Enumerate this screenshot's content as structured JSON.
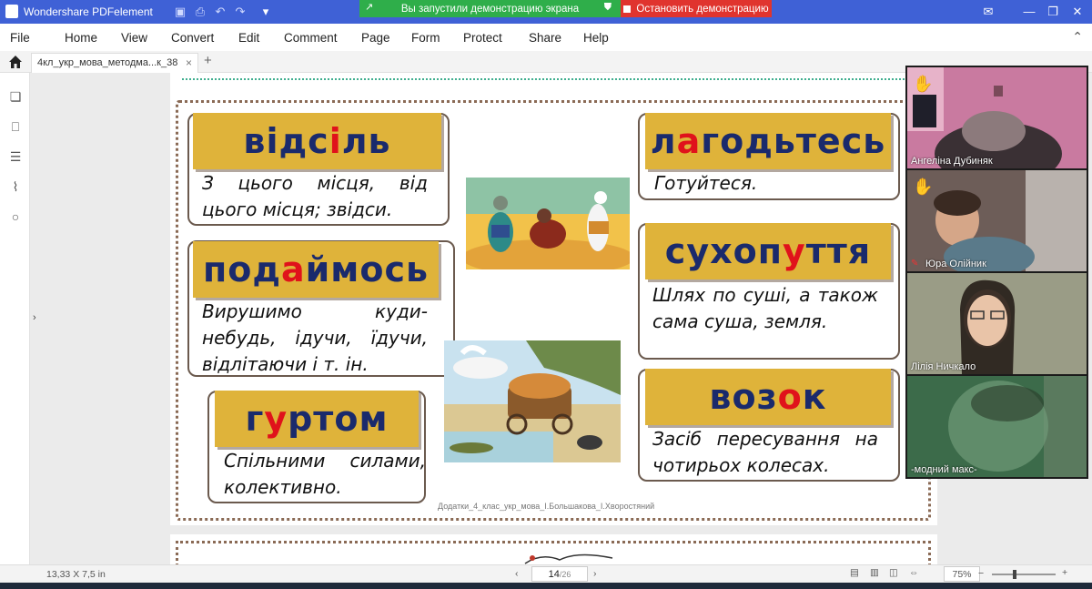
{
  "titlebar": {
    "app_title": "Wondershare PDFelement",
    "share_notice": "Вы запустили демонстрацию экрана",
    "stop_share": "Остановить демонстрацию"
  },
  "menu": [
    "File",
    "Home",
    "View",
    "Convert",
    "Edit",
    "Comment",
    "Page",
    "Form",
    "Protect",
    "Share",
    "Help"
  ],
  "tab": {
    "title": "4кл_укр_мова_методма...к_38",
    "close": "×",
    "add": "+"
  },
  "page": {
    "cards": [
      {
        "word_pre": "відс",
        "word_hl": "і",
        "word_post": "ль",
        "definition": "З цього місця, від цього місця; звідси."
      },
      {
        "word_pre": "под",
        "word_hl": "а",
        "word_post": "ймось",
        "definition": "Вирушимо куди-небудь, ідучи, їдучи, відлітаючи і т. ін."
      },
      {
        "word_pre": "г",
        "word_hl": "у",
        "word_post": "ртом",
        "definition": "Спільними силами, колективно."
      },
      {
        "word_pre": "л",
        "word_hl": "а",
        "word_post": "годьтесь",
        "definition": "Готуйтеся."
      },
      {
        "word_pre": "сухоп",
        "word_hl": "у",
        "word_post": "ття",
        "definition": "Шлях по суші, а також сама суша, земля."
      },
      {
        "word_pre": "воз",
        "word_hl": "о",
        "word_post": "к",
        "definition": "Засіб пересування на чотирьох колесах."
      }
    ],
    "footer": "Додатки_4_клас_укр_мова_І.Большакова_І.Хворостяний"
  },
  "status": {
    "page_size": "13,33 X 7,5 in",
    "page_current": "14",
    "page_total": "/26",
    "zoom": "75%"
  },
  "participants": [
    {
      "name": "Ангеліна Дубиняк",
      "hand": true
    },
    {
      "name": "Юра Олійник",
      "hand": true
    },
    {
      "name": "Лілія Ничкало",
      "hand": false
    },
    {
      "name": "-модний макс-",
      "hand": false
    }
  ],
  "colors": {
    "titlebar": "#3f61d6",
    "word_bg": "#dfb33a",
    "word_text": "#1a2a6c",
    "highlight": "#e0121b"
  }
}
